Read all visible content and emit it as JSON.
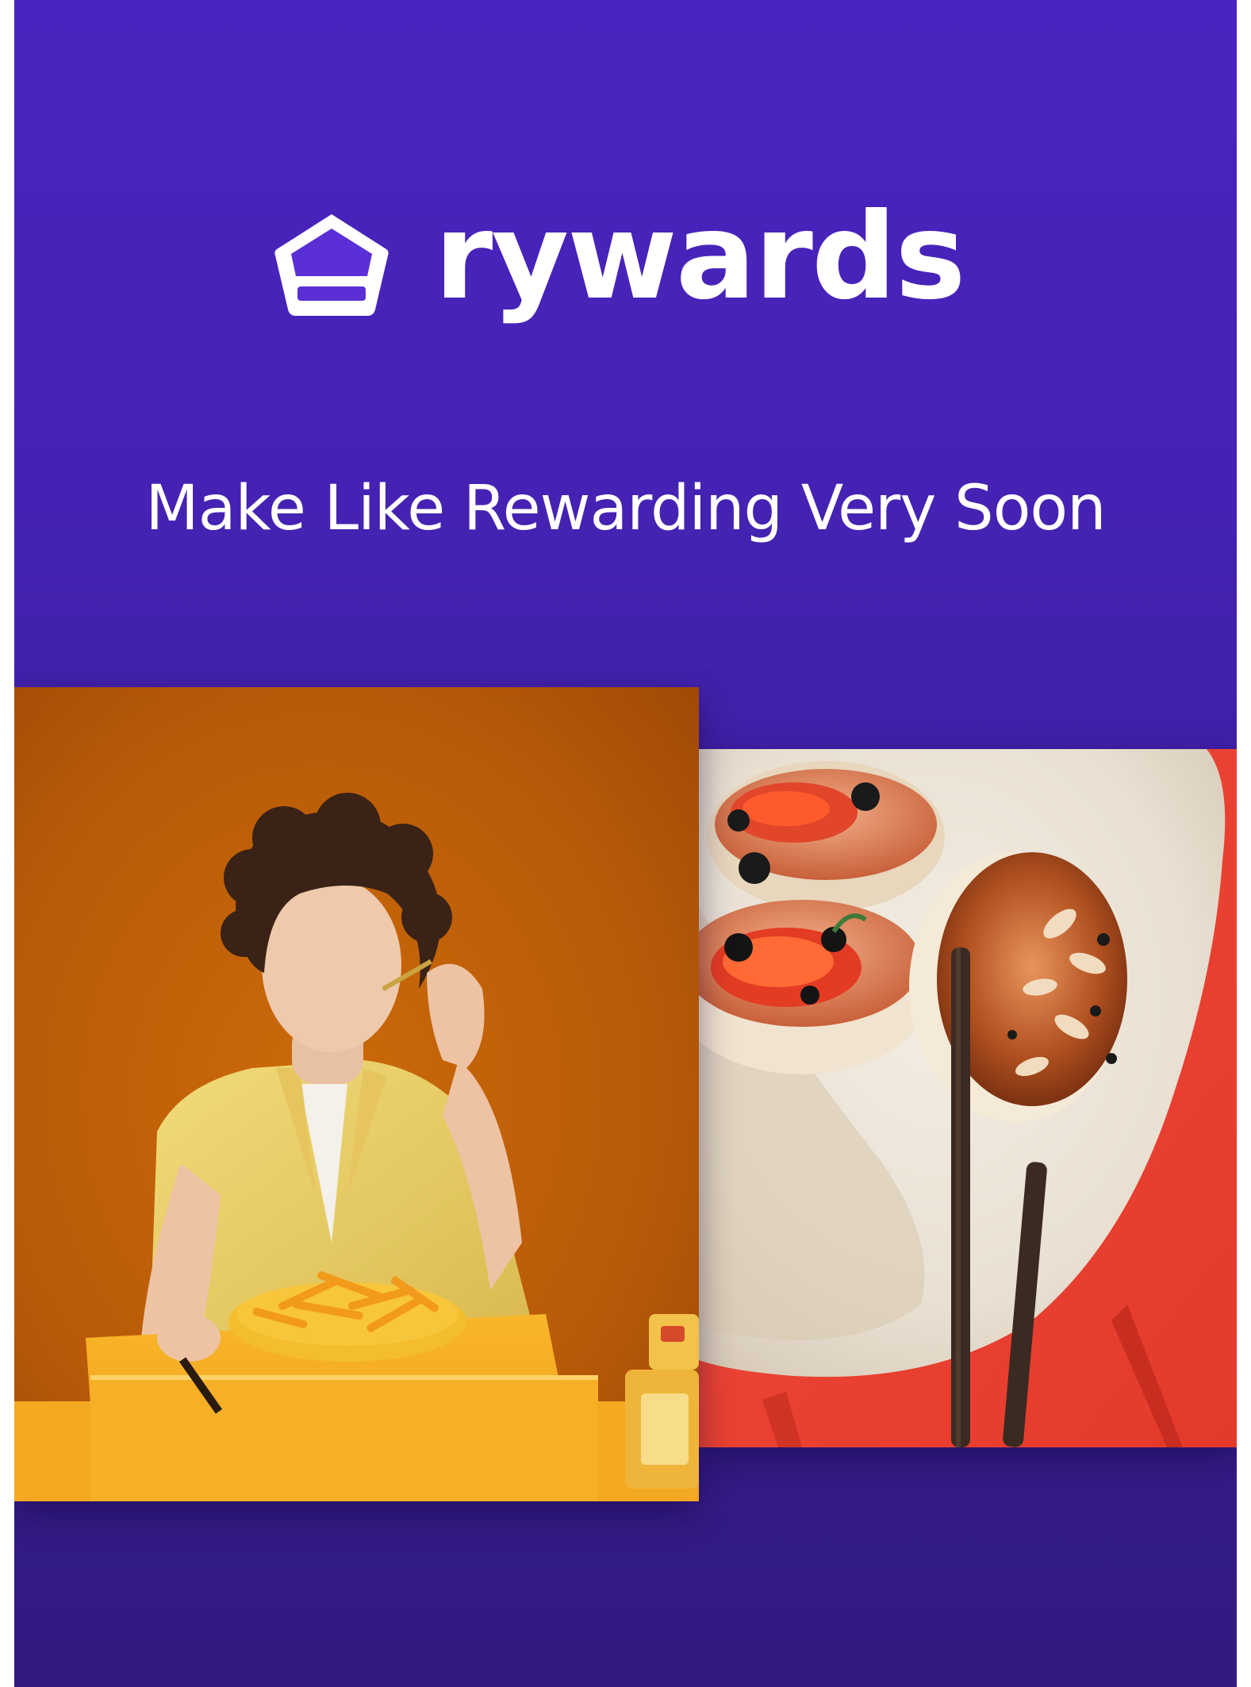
{
  "brand": {
    "name": "rywards",
    "logo_icon": "pentagon-house-icon"
  },
  "hero": {
    "tagline": "Make Like Rewarding Very Soon"
  },
  "images": {
    "left": "photo-person-eating-fries",
    "right": "photo-sushi-chopsticks"
  },
  "colors": {
    "background_top": "#4a24c0",
    "background_bottom": "#321a80",
    "logo_accent": "#5a2fd6",
    "text": "#ffffff"
  }
}
